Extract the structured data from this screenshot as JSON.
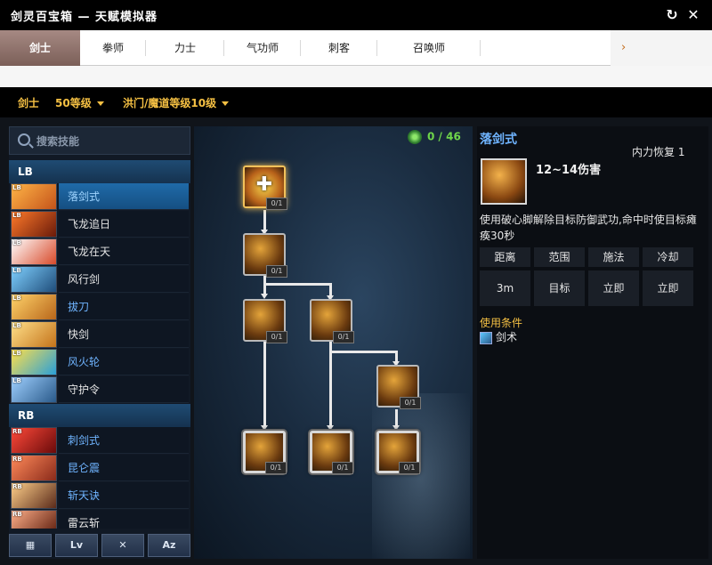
{
  "window": {
    "title": "剑灵百宝箱 — 天赋模拟器",
    "refresh_glyph": "↻",
    "close_glyph": "✕"
  },
  "tabs": [
    {
      "label": "剑士",
      "active": true
    },
    {
      "label": "拳师",
      "active": false
    },
    {
      "label": "力士",
      "active": false
    },
    {
      "label": "气功师",
      "active": false
    },
    {
      "label": "刺客",
      "active": false
    },
    {
      "label": "召唤师",
      "active": false
    }
  ],
  "tab_more_glyph": "›",
  "filters": {
    "class": "剑士",
    "level": "50等级",
    "hongmen": "洪门/魔道等级10级"
  },
  "search": {
    "placeholder": "搜索技能",
    "value": ""
  },
  "skill_groups": [
    {
      "name": "LB",
      "items": [
        {
          "tag": "LB",
          "label": "落剑式",
          "color": "blue",
          "selected": true,
          "icon_colors": [
            "#ffb547",
            "#c4531a"
          ]
        },
        {
          "tag": "LB",
          "label": "飞龙追日",
          "color": "white",
          "icon_colors": [
            "#ff7a2a",
            "#6a1a0a"
          ]
        },
        {
          "tag": "LB",
          "label": "飞龙在天",
          "color": "white",
          "icon_colors": [
            "#ffffff",
            "#d84a2a"
          ]
        },
        {
          "tag": "LB",
          "label": "风行剑",
          "color": "white",
          "icon_colors": [
            "#7fd0ff",
            "#1f4d7a"
          ]
        },
        {
          "tag": "LB",
          "label": "拔刀",
          "color": "blue",
          "icon_colors": [
            "#ffd36a",
            "#b8661a"
          ]
        },
        {
          "tag": "LB",
          "label": "快剑",
          "color": "white",
          "icon_colors": [
            "#ffe08a",
            "#c4731a"
          ]
        },
        {
          "tag": "LB",
          "label": "风火轮",
          "color": "blue",
          "icon_colors": [
            "#ffe04a",
            "#2a9fd8"
          ]
        },
        {
          "tag": "LB",
          "label": "守护令",
          "color": "white",
          "icon_colors": [
            "#9fd0ff",
            "#2a5a8a"
          ]
        }
      ]
    },
    {
      "name": "RB",
      "items": [
        {
          "tag": "RB",
          "label": "刺剑式",
          "color": "blue",
          "icon_colors": [
            "#ff4a3a",
            "#6a0a0a"
          ]
        },
        {
          "tag": "RB",
          "label": "昆仑震",
          "color": "blue",
          "icon_colors": [
            "#ff8a5a",
            "#8a2a1a"
          ]
        },
        {
          "tag": "RB",
          "label": "斩天诀",
          "color": "blue",
          "icon_colors": [
            "#ffd08a",
            "#5a2a1a"
          ]
        },
        {
          "tag": "RB",
          "label": "雷云斩",
          "color": "white",
          "icon_colors": [
            "#ffb08a",
            "#5a1a0a"
          ]
        }
      ]
    }
  ],
  "bottom_buttons": [
    {
      "name": "grid",
      "label": "▦"
    },
    {
      "name": "level-sort",
      "label": "Lv"
    },
    {
      "name": "tools",
      "label": "✕"
    },
    {
      "name": "alpha-sort",
      "label": "Az"
    }
  ],
  "tree": {
    "points": "0 / 46",
    "node_level": "0/1",
    "root_glyph": "✚"
  },
  "detail": {
    "name": "落剑式",
    "regen": "内力恢复 1",
    "damage": "12~14伤害",
    "description": "使用破心脚解除目标防御武功,命中时使目标瘫痪30秒",
    "stats": [
      {
        "label": "距离",
        "value": "3m"
      },
      {
        "label": "范围",
        "value": "目标"
      },
      {
        "label": "施法",
        "value": "立即"
      },
      {
        "label": "冷却",
        "value": "立即"
      }
    ],
    "condition_label": "使用条件",
    "condition": "剑术"
  },
  "colors": {
    "accent_gold": "#f5c043",
    "skill_blue": "#6fb4ff",
    "points_green": "#6fd64a",
    "active_tab": "#8e716a"
  }
}
